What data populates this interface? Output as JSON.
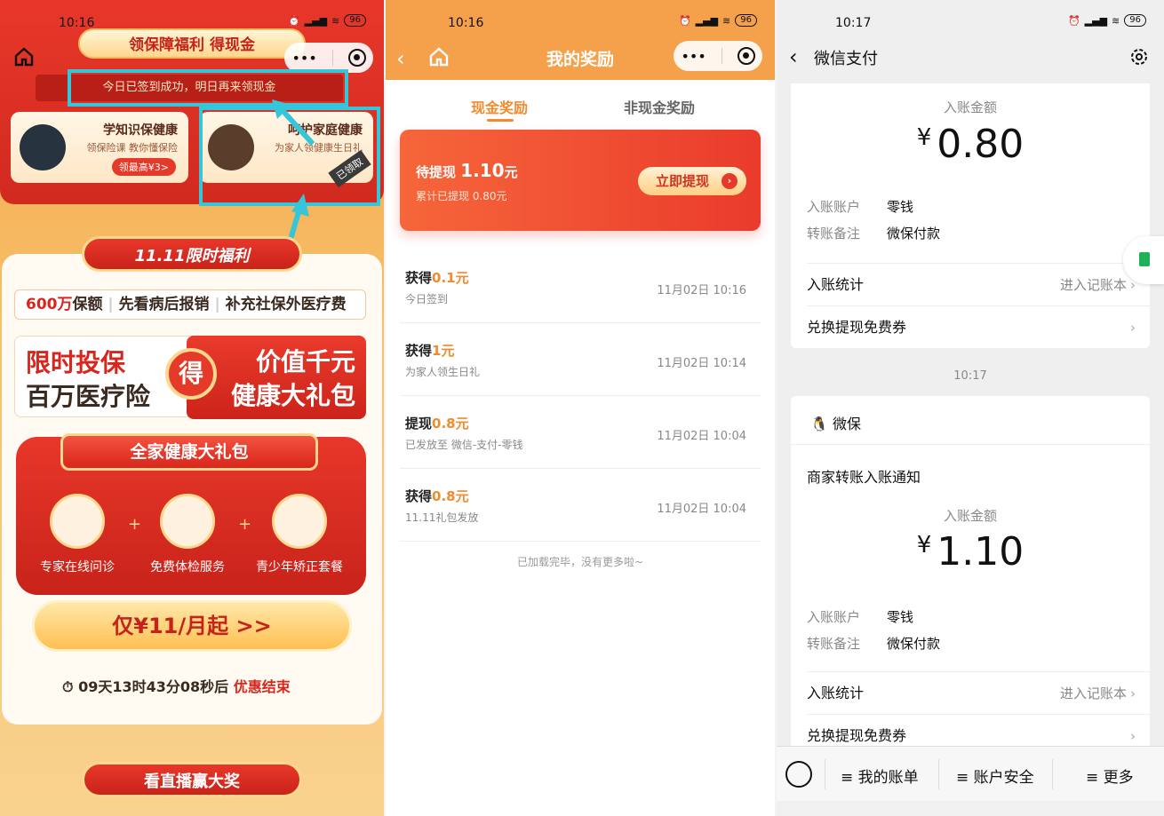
{
  "panel1": {
    "status": {
      "time": "10:16",
      "battery": "96"
    },
    "ribbon": "领保障福利 得现金",
    "signin": "今日已签到成功，明日再来领现金",
    "card_learn": {
      "title": "学知识保健康",
      "subtitle": "领保险课 教你懂保险",
      "pill": "领最高¥3>"
    },
    "card_family": {
      "title": "呵护家庭健康",
      "subtitle": "为家人领健康生日礼",
      "stamp": "已领取"
    },
    "section_title": "11.11限时福利",
    "tags": {
      "t1_red": "600万",
      "t1": "保额",
      "t2": "先看病后报销",
      "t3": "补充社保外医疗费"
    },
    "promo_left": {
      "line1": "限时投保",
      "line2": "百万医疗险"
    },
    "promo_mid": "得",
    "promo_right": {
      "line1": "价值千元",
      "line2": "健康大礼包"
    },
    "gift": {
      "title": "全家健康大礼包",
      "items": [
        "专家在线问诊",
        "免费体检服务",
        "青少年矫正套餐"
      ],
      "plus": "+"
    },
    "cta": "仅¥11/月起 >>",
    "timer": {
      "time": "09天13时43分08秒后",
      "label": "优惠结束"
    },
    "bottom_title": "看直播赢大奖"
  },
  "panel2": {
    "status": {
      "time": "10:16",
      "battery": "96"
    },
    "title": "我的奖励",
    "tabs": [
      "现金奖励",
      "非现金奖励"
    ],
    "withdraw": {
      "pending_label": "待提现",
      "pending_amount": "1.10",
      "unit": "元",
      "total": "累计已提现 0.80元",
      "button": "立即提现"
    },
    "records": [
      {
        "action": "获得",
        "amount": "0.1元",
        "desc": "今日签到",
        "date": "11月02日 10:16"
      },
      {
        "action": "获得",
        "amount": "1元",
        "desc": "为家人领生日礼",
        "date": "11月02日 10:14"
      },
      {
        "action": "提现",
        "amount": "0.8元",
        "desc": "已发放至 微信-支付-零钱",
        "date": "11月02日 10:04"
      },
      {
        "action": "获得",
        "amount": "0.8元",
        "desc": "11.11礼包发放",
        "date": "11月02日 10:04"
      }
    ],
    "loaded": "已加载完毕，没有更多啦~"
  },
  "panel3": {
    "status": {
      "time": "10:17",
      "battery": "96"
    },
    "title": "微信支付",
    "msg1": {
      "amount_label": "入账金额",
      "currency": "¥",
      "amount": "0.80",
      "account_label": "入账账户",
      "account": "零钱",
      "remark_label": "转账备注",
      "remark": "微保付款",
      "stats_label": "入账统计",
      "stats_link": "进入记账本",
      "voucher_label": "兑换提现免费券"
    },
    "time_sep": "10:17",
    "msg2": {
      "sender": "微保",
      "notice": "商家转账入账通知",
      "amount_label": "入账金额",
      "currency": "¥",
      "amount": "1.10",
      "account_label": "入账账户",
      "account": "零钱",
      "remark_label": "转账备注",
      "remark": "微保付款",
      "stats_label": "入账统计",
      "stats_link": "进入记账本",
      "voucher_label": "兑换提现免费券"
    },
    "bottom": [
      "≡ 我的账单",
      "≡ 账户安全",
      "≡ 更多"
    ]
  },
  "colors": {
    "orange": "#f5a04a",
    "red": "#e53a2a",
    "highlight": "#35c7d9",
    "wechat_green": "#1fb155"
  }
}
